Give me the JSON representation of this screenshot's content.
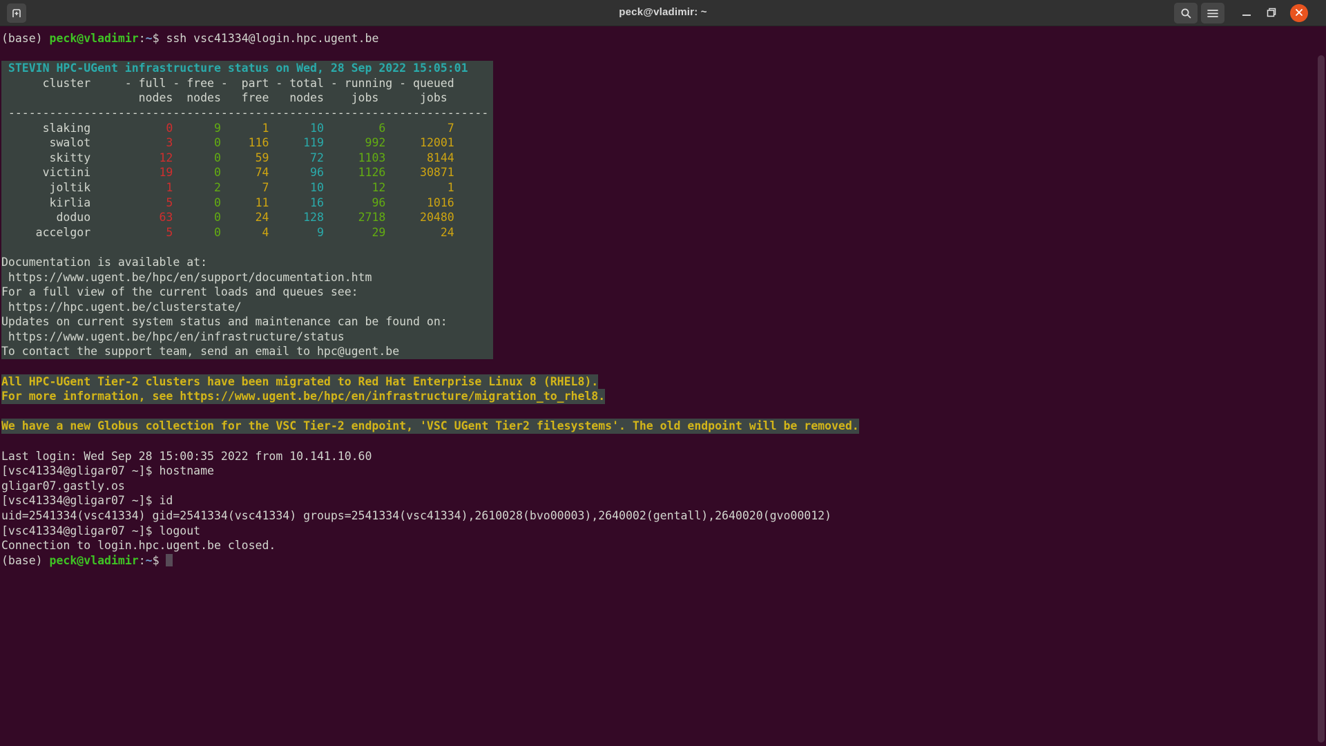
{
  "window": {
    "title": "peck@vladimir: ~"
  },
  "colors": {
    "terminal_background": "#340926",
    "block_background": "#39423f",
    "close_button_orange": "#E9541F",
    "ansi_red": "#d02e2e",
    "ansi_green": "#63ad11",
    "ansi_yellow": "#cfa511",
    "ansi_cyan": "#2aabab",
    "prompt_green": "#3fc424",
    "prompt_blue": "#729fcf"
  },
  "prompt": {
    "venv": "(base) ",
    "user": "peck@vladimir",
    "colon": ":",
    "path": "~",
    "dollar": "$ "
  },
  "session": {
    "ssh_command": "ssh vsc41334@login.hpc.ugent.be",
    "last_login": "Last login: Wed Sep 28 15:00:35 2022 from 10.141.10.60",
    "remote_cmd_hostname": "[vsc41334@gligar07 ~]$ hostname",
    "hostname_output": "gligar07.gastly.os",
    "remote_cmd_id": "[vsc41334@gligar07 ~]$ id",
    "id_output": "uid=2541334(vsc41334) gid=2541334(vsc41334) groups=2541334(vsc41334),2610028(bvo00003),2640002(gentall),2640020(gvo00012)",
    "remote_cmd_logout": "[vsc41334@gligar07 ~]$ logout",
    "connection_closed": "Connection to login.hpc.ugent.be closed."
  },
  "status_block": {
    "title": " STEVIN HPC-UGent infrastructure status on Wed, 28 Sep 2022 15:05:01",
    "header_line1": "      cluster     - full - free -  part - total - running - queued",
    "header_line2": "                    nodes  nodes   free   nodes    jobs      jobs",
    "divider": " ----------------------------------------------------------------------",
    "table": {
      "type": "table",
      "columns": [
        "cluster",
        "full nodes",
        "free nodes",
        "part free",
        "total nodes",
        "running jobs",
        "queued jobs"
      ],
      "rows": [
        {
          "cluster": "slaking",
          "full": "0",
          "free": "9",
          "part_free": "1",
          "total": "10",
          "running": "6",
          "queued": "7"
        },
        {
          "cluster": "swalot",
          "full": "3",
          "free": "0",
          "part_free": "116",
          "total": "119",
          "running": "992",
          "queued": "12001"
        },
        {
          "cluster": "skitty",
          "full": "12",
          "free": "0",
          "part_free": "59",
          "total": "72",
          "running": "1103",
          "queued": "8144"
        },
        {
          "cluster": "victini",
          "full": "19",
          "free": "0",
          "part_free": "74",
          "total": "96",
          "running": "1126",
          "queued": "30871"
        },
        {
          "cluster": "joltik",
          "full": "1",
          "free": "2",
          "part_free": "7",
          "total": "10",
          "running": "12",
          "queued": "1"
        },
        {
          "cluster": "kirlia",
          "full": "5",
          "free": "0",
          "part_free": "11",
          "total": "16",
          "running": "96",
          "queued": "1016"
        },
        {
          "cluster": "doduo",
          "full": "63",
          "free": "0",
          "part_free": "24",
          "total": "128",
          "running": "2718",
          "queued": "20480"
        },
        {
          "cluster": "accelgor",
          "full": "5",
          "free": "0",
          "part_free": "4",
          "total": "9",
          "running": "29",
          "queued": "24"
        }
      ]
    },
    "docs": [
      "Documentation is available at:",
      " https://www.ugent.be/hpc/en/support/documentation.htm",
      "For a full view of the current loads and queues see:",
      " https://hpc.ugent.be/clusterstate/",
      "Updates on current system status and maintenance can be found on:",
      " https://www.ugent.be/hpc/en/infrastructure/status",
      "To contact the support team, send an email to hpc@ugent.be"
    ]
  },
  "notices": {
    "rhel_line1": "All HPC-UGent Tier-2 clusters have been migrated to Red Hat Enterprise Linux 8 (RHEL8).",
    "rhel_line2": "For more information, see https://www.ugent.be/hpc/en/infrastructure/migration_to_rhel8.",
    "globus": "We have a new Globus collection for the VSC Tier-2 endpoint, 'VSC UGent Tier2 filesystems'. The old endpoint will be removed."
  }
}
